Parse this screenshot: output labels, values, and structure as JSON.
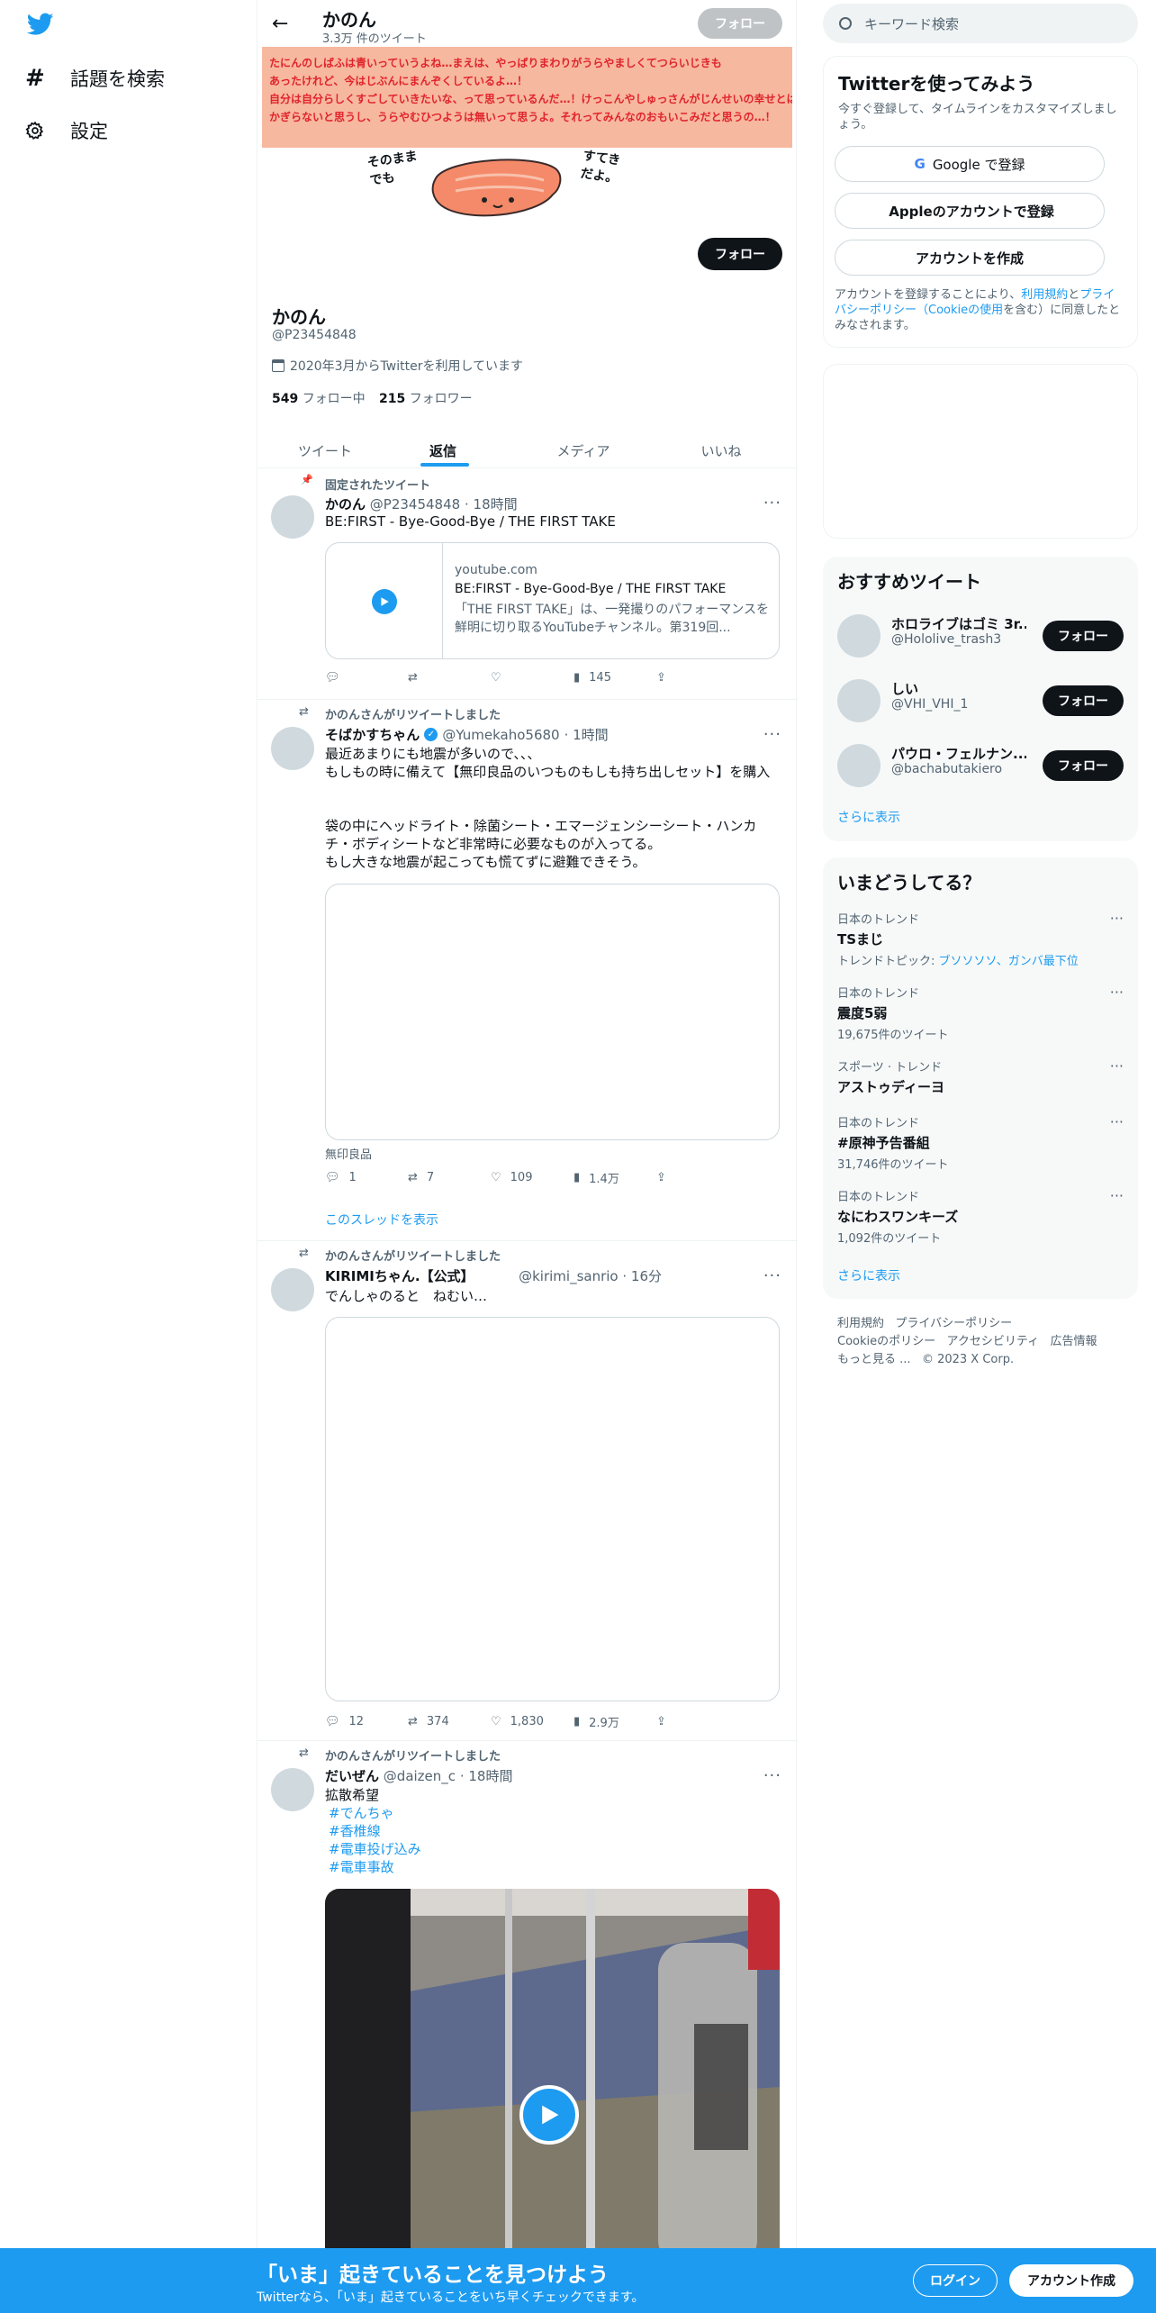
{
  "nav": {
    "explore_label": "話題を検索",
    "settings_label": "設定"
  },
  "header": {
    "name": "かのん",
    "tweet_count": "3.3万 件のツイート",
    "follow_label": "フォロー"
  },
  "banner": {
    "line1": "たにんのしばふは青いっていうよね…まえは、やっぱりまわりがうらやましくてつらいじきも",
    "line2": "あったけれど、今はじぶんにまんぞくしているよ…！",
    "line3": "自分は自分らしくすごしていきたいな、って思っているんだ…！けっこんやしゅっさんがじんせいの幸せとは",
    "line4": "かぎらないと思うし、うらやむひつようは無いって思うよ。それってみんなのおもいこみだと思うの…！",
    "text_left": "そのまま でも",
    "text_right": "すてき だよ。"
  },
  "profile": {
    "name": "かのん",
    "handle": "@P23454848",
    "joined": "2020年3月からTwitterを利用しています",
    "following_count": "549",
    "following_label": "フォロー中",
    "followers_count": "215",
    "followers_label": "フォロワー",
    "follow_label": "フォロー"
  },
  "tabs": [
    "ツイート",
    "返信",
    "メディア",
    "いいね"
  ],
  "tweets": [
    {
      "context": "固定されたツイート",
      "name": "かのん",
      "handle": "@P23454848",
      "time": "· 18時間",
      "text": "BE:FIRST - Bye-Good-Bye / THE FIRST TAKE",
      "card_domain": "youtube.com",
      "card_title": "BE:FIRST - Bye-Good-Bye / THE FIRST TAKE",
      "card_desc": "「THE FIRST TAKE」は、一発撮りのパフォーマンスを鮮明に切り取るYouTubeチャンネル。第319回...",
      "views": "145"
    },
    {
      "context": "かのんさんがリツイートしました",
      "name": "そばかすちゃん",
      "handle": "@Yumekaho5680",
      "time": "· 1時間",
      "text1": "最近あまりにも地震が多いので、、、",
      "text2": "もしもの時に備えて【無印良品のいつものもしも持ち出しセット】を購入",
      "text3": "袋の中にヘッドライト・除菌シート・エマージェンシーシート・ハンカ",
      "text4": "チ・ボディシートなど非常時に必要なものが入ってる。",
      "text5": "もし大きな地震が起こっても慌てずに避難できそう。",
      "caption": "無印良品",
      "replies": "1",
      "retweets": "7",
      "likes": "109",
      "views": "1.4万",
      "show_thread": "このスレッドを表示"
    },
    {
      "context": "かのんさんがリツイートしました",
      "name": "KIRIMIちゃん.【公式】",
      "handle": "@kirimi_sanrio",
      "time": "· 16分",
      "text": "でんしゃのると　ねむい…",
      "replies": "12",
      "retweets": "374",
      "likes": "1,830",
      "views": "2.9万"
    },
    {
      "context": "かのんさんがリツイートしました",
      "name": "だいぜん",
      "handle": "@daizen_c",
      "time": "· 18時間",
      "text": "拡散希望",
      "tags": [
        "#でんちゃ",
        "#香椎線",
        "#電車投げ込み",
        "#電車事故"
      ]
    }
  ],
  "search": {
    "placeholder": "キーワード検索"
  },
  "signup": {
    "title": "Twitterを使ってみよう",
    "subtitle": "今すぐ登録して、タイムラインをカスタマイズしましょう。",
    "google_label": "Google で登録",
    "apple_label": "Appleのアカウントで登録",
    "create_label": "アカウントを作成",
    "terms_pre": "アカウントを登録することにより、",
    "terms_link1": "利用規約",
    "terms_mid": "と",
    "terms_link2": "プライバシーポリシー（Cookieの使用",
    "terms_post": "を含む）に同意したとみなされます。"
  },
  "recommend": {
    "title": "おすすめツイート",
    "users": [
      {
        "name": "ホロライブはゴミ 3r...",
        "handle": "@Hololive_trash3",
        "follow": "フォロー"
      },
      {
        "name": "しい",
        "handle": "@VHI_VHI_1",
        "follow": "フォロー"
      },
      {
        "name": "パウロ・フェルナン...",
        "handle": "@bachabutakiero",
        "follow": "フォロー"
      }
    ],
    "more": "さらに表示"
  },
  "trends": {
    "title": "いまどうしてる？",
    "items": [
      {
        "meta": "日本のトレンド",
        "name": "TSまじ",
        "extra_pre": "トレンドトピック: ",
        "extra_link": "ブソソソソ、ガンバ最下位"
      },
      {
        "meta": "日本のトレンド",
        "name": "震度5弱",
        "count": "19,675件のツイート"
      },
      {
        "meta": "スポーツ · トレンド",
        "name": "アストゥディーヨ"
      },
      {
        "meta": "日本のトレンド",
        "name": "#原神予告番組",
        "count": "31,746件のツイート"
      },
      {
        "meta": "日本のトレンド",
        "name": "なにわスワンキーズ",
        "count": "1,092件のツイート"
      }
    ],
    "more": "さらに表示"
  },
  "footer": {
    "terms": "利用規約",
    "privacy": "プライバシーポリシー",
    "cookie": "Cookieのポリシー",
    "accessibility": "アクセシビリティ",
    "ads": "広告情報",
    "more": "もっと見る ...",
    "copyright": "© 2023 X Corp."
  },
  "bottombar": {
    "title": "「いま」起きていることを見つけよう",
    "subtitle": "Twitterなら、「いま」起きていることをいち早くチェックできます。",
    "login": "ログイン",
    "signup": "アカウント作成"
  },
  "colors": {
    "accent": "#1d9bf0",
    "banner_bg": "#f7b8a0",
    "banner_text": "#e0242b"
  }
}
